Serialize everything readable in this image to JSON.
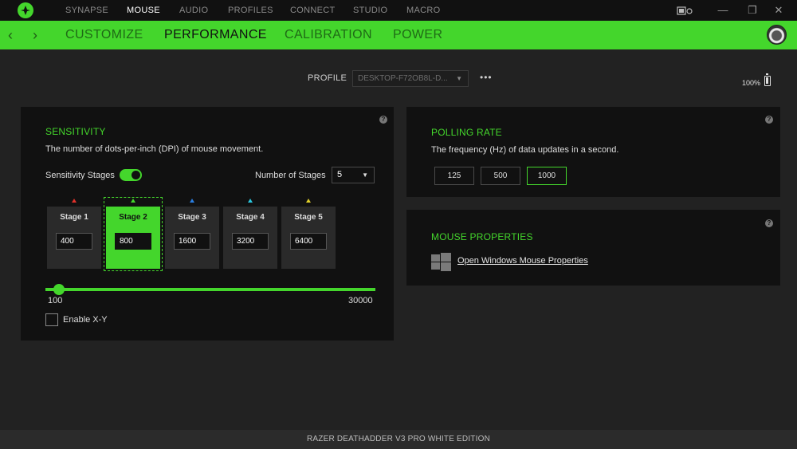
{
  "top_nav": {
    "items": [
      {
        "label": "SYNAPSE"
      },
      {
        "label": "MOUSE"
      },
      {
        "label": "AUDIO"
      },
      {
        "label": "PROFILES"
      },
      {
        "label": "CONNECT"
      },
      {
        "label": "STUDIO"
      },
      {
        "label": "MACRO"
      }
    ],
    "active": "MOUSE"
  },
  "window_controls": {
    "minimize": "—",
    "restore": "❐",
    "close": "✕"
  },
  "sub_nav": {
    "tabs": [
      {
        "label": "CUSTOMIZE"
      },
      {
        "label": "PERFORMANCE"
      },
      {
        "label": "CALIBRATION"
      },
      {
        "label": "POWER"
      }
    ],
    "active": "PERFORMANCE",
    "back_glyph": "‹",
    "forward_glyph": "›"
  },
  "profile": {
    "label": "PROFILE",
    "selected": "DESKTOP-F72OB8L-D...",
    "more": "•••"
  },
  "battery": {
    "text": "100%",
    "level": 1.0
  },
  "sensitivity": {
    "title": "SENSITIVITY",
    "description": "The number of dots-per-inch (DPI) of mouse movement.",
    "stages_label": "Sensitivity Stages",
    "stages_enabled": true,
    "num_stages_label": "Number of Stages",
    "num_stages": "5",
    "stages": [
      {
        "name": "Stage 1",
        "value": "400",
        "marker_color": "#e0302a"
      },
      {
        "name": "Stage 2",
        "value": "800",
        "marker_color": "#44d62c"
      },
      {
        "name": "Stage 3",
        "value": "1600",
        "marker_color": "#2a7ee0"
      },
      {
        "name": "Stage 4",
        "value": "3200",
        "marker_color": "#2ac8e0"
      },
      {
        "name": "Stage 5",
        "value": "6400",
        "marker_color": "#e0d02a"
      }
    ],
    "active_stage": 2,
    "slider_min": "100",
    "slider_max": "30000",
    "enable_xy_label": "Enable X-Y",
    "enable_xy": false
  },
  "polling": {
    "title": "POLLING RATE",
    "description": "The frequency (Hz) of data updates in a second.",
    "options": [
      "125",
      "500",
      "1000"
    ],
    "selected": "1000"
  },
  "mouse_properties": {
    "title": "MOUSE PROPERTIES",
    "link": "Open Windows Mouse Properties"
  },
  "help_glyph": "?",
  "footer": {
    "device": "RAZER DEATHADDER V3 PRO WHITE EDITION"
  },
  "colors": {
    "accent": "#44d62c",
    "panel": "#111111",
    "background": "#222222"
  }
}
